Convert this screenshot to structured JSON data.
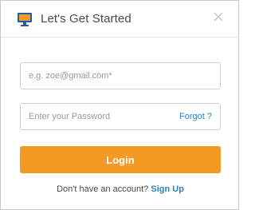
{
  "header": {
    "title": "Let's Get Started",
    "logo_icon": "monitor-icon",
    "close_icon": "close-icon"
  },
  "form": {
    "email_placeholder": "e.g. zoe@gmail.com*",
    "email_value": "",
    "password_placeholder": "Enter your Password",
    "password_value": "",
    "forgot_label": "Forgot ?",
    "login_label": "Login"
  },
  "footer": {
    "prompt": "Don't have an account?",
    "signup_label": "Sign Up"
  },
  "colors": {
    "accent": "#f49a24",
    "link": "#2f7fc8",
    "logo_blue": "#1f5fa8",
    "logo_orange": "#f49a24"
  }
}
